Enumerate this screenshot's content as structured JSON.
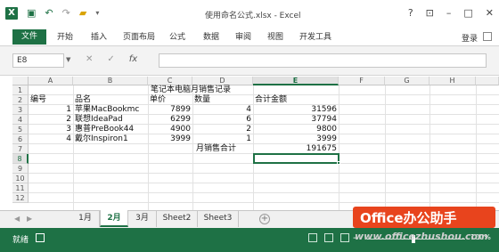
{
  "window": {
    "title": "使用命名公式.xlsx - Excel",
    "controls": [
      "?",
      "⊡",
      "–",
      "□",
      "✕"
    ]
  },
  "qat": {
    "logo": "X",
    "save_icon": "save-icon",
    "undo_icon": "undo-icon",
    "redo_icon": "redo-icon"
  },
  "ribbon": {
    "tabs": [
      "文件",
      "开始",
      "插入",
      "页面布局",
      "公式",
      "数据",
      "审阅",
      "视图",
      "开发工具"
    ],
    "login": "登录"
  },
  "formula_bar": {
    "name_box": "E8",
    "cancel": "✕",
    "enter": "✓",
    "fx": "fx",
    "value": ""
  },
  "grid": {
    "columns": [
      "A",
      "B",
      "C",
      "D",
      "E",
      "F",
      "G",
      "H"
    ],
    "selected_column": "E",
    "rows": [
      "1",
      "2",
      "3",
      "4",
      "5",
      "6",
      "7",
      "8",
      "9",
      "10",
      "11",
      "12"
    ],
    "selected_row": "8",
    "title": "笔记本电脑月销售记录",
    "headers": {
      "a": "编号",
      "b": "品名",
      "c": "单价",
      "d": "数量",
      "e": "合计金额"
    },
    "data": [
      {
        "a": "1",
        "b": "苹果MacBookmc",
        "c": "7899",
        "d": "4",
        "e": "31596"
      },
      {
        "a": "2",
        "b": "联想IdeaPad",
        "c": "6299",
        "d": "6",
        "e": "37794"
      },
      {
        "a": "3",
        "b": "惠普PreBook44",
        "c": "4900",
        "d": "2",
        "e": "9800"
      },
      {
        "a": "4",
        "b": "戴尔Inspiron1",
        "c": "3999",
        "d": "1",
        "e": "3999"
      }
    ],
    "total_label": "月销售合计",
    "total_value": "191675"
  },
  "sheets": {
    "tabs": [
      "1月",
      "2月",
      "3月",
      "Sheet2",
      "Sheet3"
    ],
    "active": "2月",
    "add": "+"
  },
  "status": {
    "mode": "就绪",
    "zoom_minus": "–",
    "zoom": "100%"
  },
  "watermark": {
    "brand": "Office办公助手",
    "url": "www.officezhushou.com"
  },
  "colors": {
    "excel_green": "#1e7145",
    "watermark_orange": "#e8441d"
  }
}
